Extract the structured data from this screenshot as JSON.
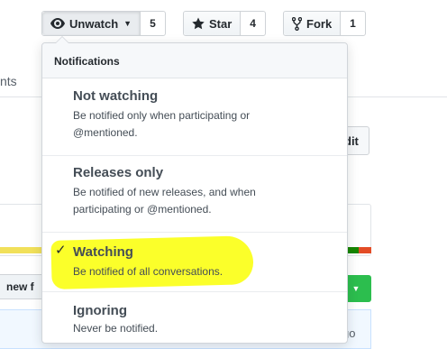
{
  "header": {
    "unwatch_label": "Unwatch",
    "unwatch_count": "5",
    "star_label": "Star",
    "star_count": "4",
    "fork_label": "Fork",
    "fork_count": "1"
  },
  "background": {
    "nav_fragment": "nts",
    "edit_fragment": "dit",
    "branch_fragment": "new f",
    "time_fragment": "go"
  },
  "notifications": {
    "header": "Notifications",
    "options": [
      {
        "title": "Not watching",
        "desc_line1": "Be notified only when participating or",
        "desc_line2": "@mentioned.",
        "selected": false
      },
      {
        "title": "Releases only",
        "desc_line1": "Be notified of new releases, and when",
        "desc_line2": "participating or @mentioned.",
        "selected": false
      },
      {
        "title": "Watching",
        "desc_line1": "Be notified of all conversations.",
        "selected": true
      },
      {
        "title": "Ignoring",
        "desc_line1": "Never be notified.",
        "selected": false
      }
    ],
    "check_glyph": "✓"
  },
  "colors": {
    "highlight": "#ffff2e",
    "lang_bar_yellow": "#f1e05a",
    "lang_bar_green": "#178600",
    "lang_bar_red": "#e34c26",
    "primary_green": "#2cbe4e"
  }
}
